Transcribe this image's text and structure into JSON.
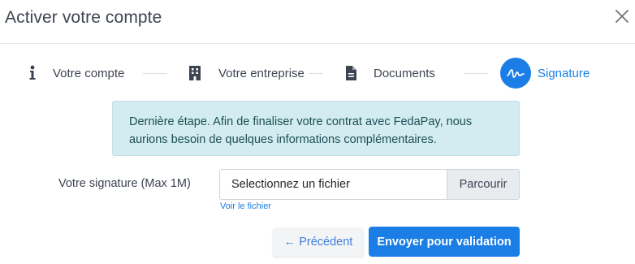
{
  "modal": {
    "title": "Activer votre compte",
    "close_icon": "close-icon"
  },
  "stepper": {
    "steps": [
      {
        "label": "Votre compte",
        "icon": "info-icon",
        "active": false
      },
      {
        "label": "Votre entreprise",
        "icon": "building-icon",
        "active": false
      },
      {
        "label": "Documents",
        "icon": "document-icon",
        "active": false
      },
      {
        "label": "Signature",
        "icon": "signature-icon",
        "active": true
      }
    ],
    "active_color": "#1a7ee6"
  },
  "alert": {
    "text": "Dernière étape. Afin de finaliser votre contrat avec FedaPay, nous aurions besoin de quelques informations complémentaires."
  },
  "form": {
    "signature_label": "Votre signature (Max 1M)",
    "file_placeholder": "Selectionnez un fichier",
    "browse_label": "Parcourir",
    "view_link": "Voir le fichier"
  },
  "actions": {
    "previous_label": "← Précédent",
    "submit_label": "Envoyer pour validation"
  }
}
